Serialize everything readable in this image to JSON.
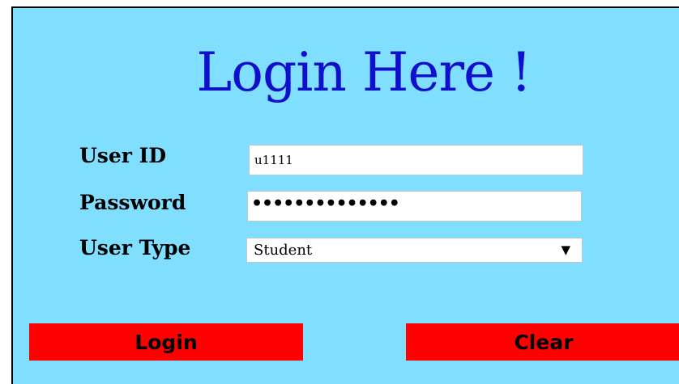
{
  "title": "Login Here !",
  "form": {
    "user_id_label": "User ID",
    "user_id_value": "u1111",
    "password_label": "Password",
    "password_masked": "••••••••••••••",
    "user_type_label": "User Type",
    "user_type_value": "Student",
    "user_type_arrow": "▼"
  },
  "buttons": {
    "login_label": "Login",
    "clear_label": "Clear"
  },
  "colors": {
    "panel_bg": "#80dfff",
    "title": "#1010cc",
    "button_bg": "#ff0000"
  }
}
